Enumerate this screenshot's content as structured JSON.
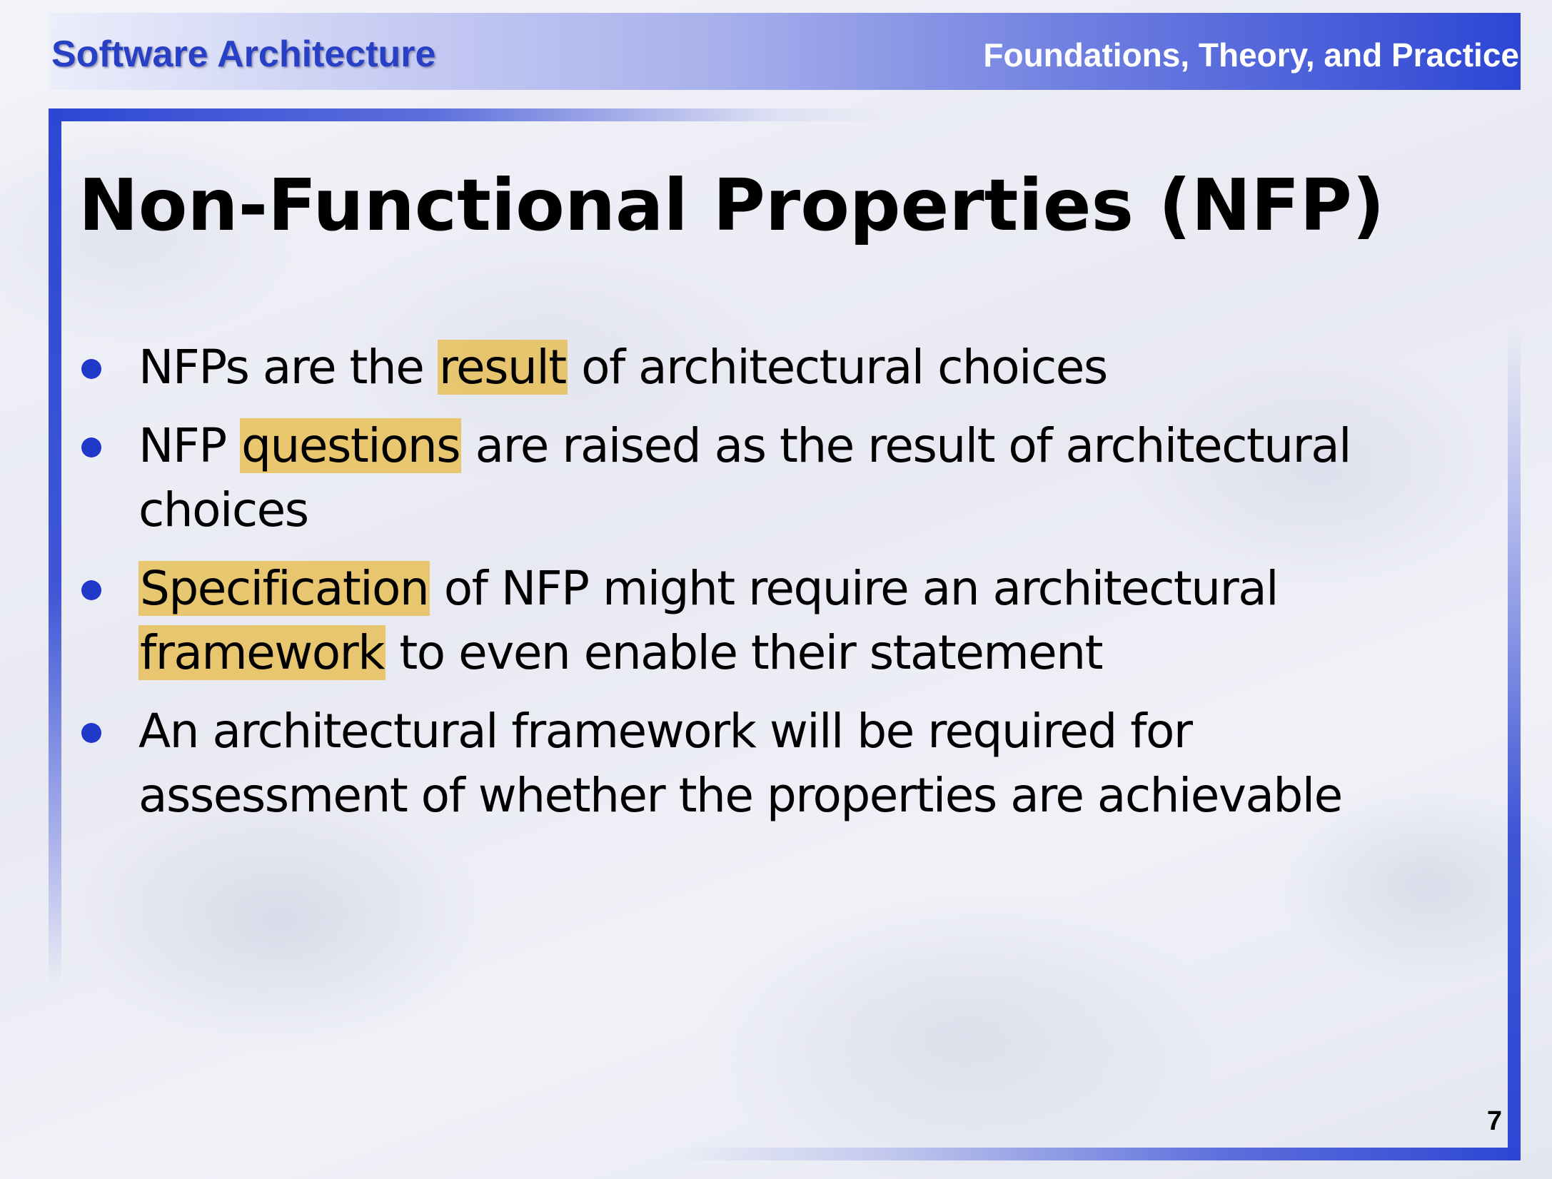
{
  "header": {
    "left_title": "Software Architecture",
    "right_title": "Foundations, Theory, and Practice"
  },
  "slide": {
    "title": "Non-Functional Properties (NFP)",
    "bullets": [
      {
        "segments": [
          {
            "text": "NFPs are the ",
            "highlight": false
          },
          {
            "text": "result",
            "highlight": true
          },
          {
            "text": " of architectural choices",
            "highlight": false
          }
        ]
      },
      {
        "segments": [
          {
            "text": "NFP ",
            "highlight": false
          },
          {
            "text": "questions",
            "highlight": true
          },
          {
            "text": " are raised as the result of architectural choices",
            "highlight": false
          }
        ]
      },
      {
        "segments": [
          {
            "text": "Specification",
            "highlight": true
          },
          {
            "text": " of NFP might require an architectural ",
            "highlight": false
          },
          {
            "text": "framework",
            "highlight": true
          },
          {
            "text": " to even enable their statement",
            "highlight": false
          }
        ]
      },
      {
        "segments": [
          {
            "text": "An architectural framework will be required for assessment of whether the properties are achievable",
            "highlight": false
          }
        ]
      }
    ],
    "page_number": "7"
  },
  "colors": {
    "accent_blue": "#2d46d4",
    "header_text_blue": "#2840c6",
    "highlight": "#e6b93c"
  }
}
